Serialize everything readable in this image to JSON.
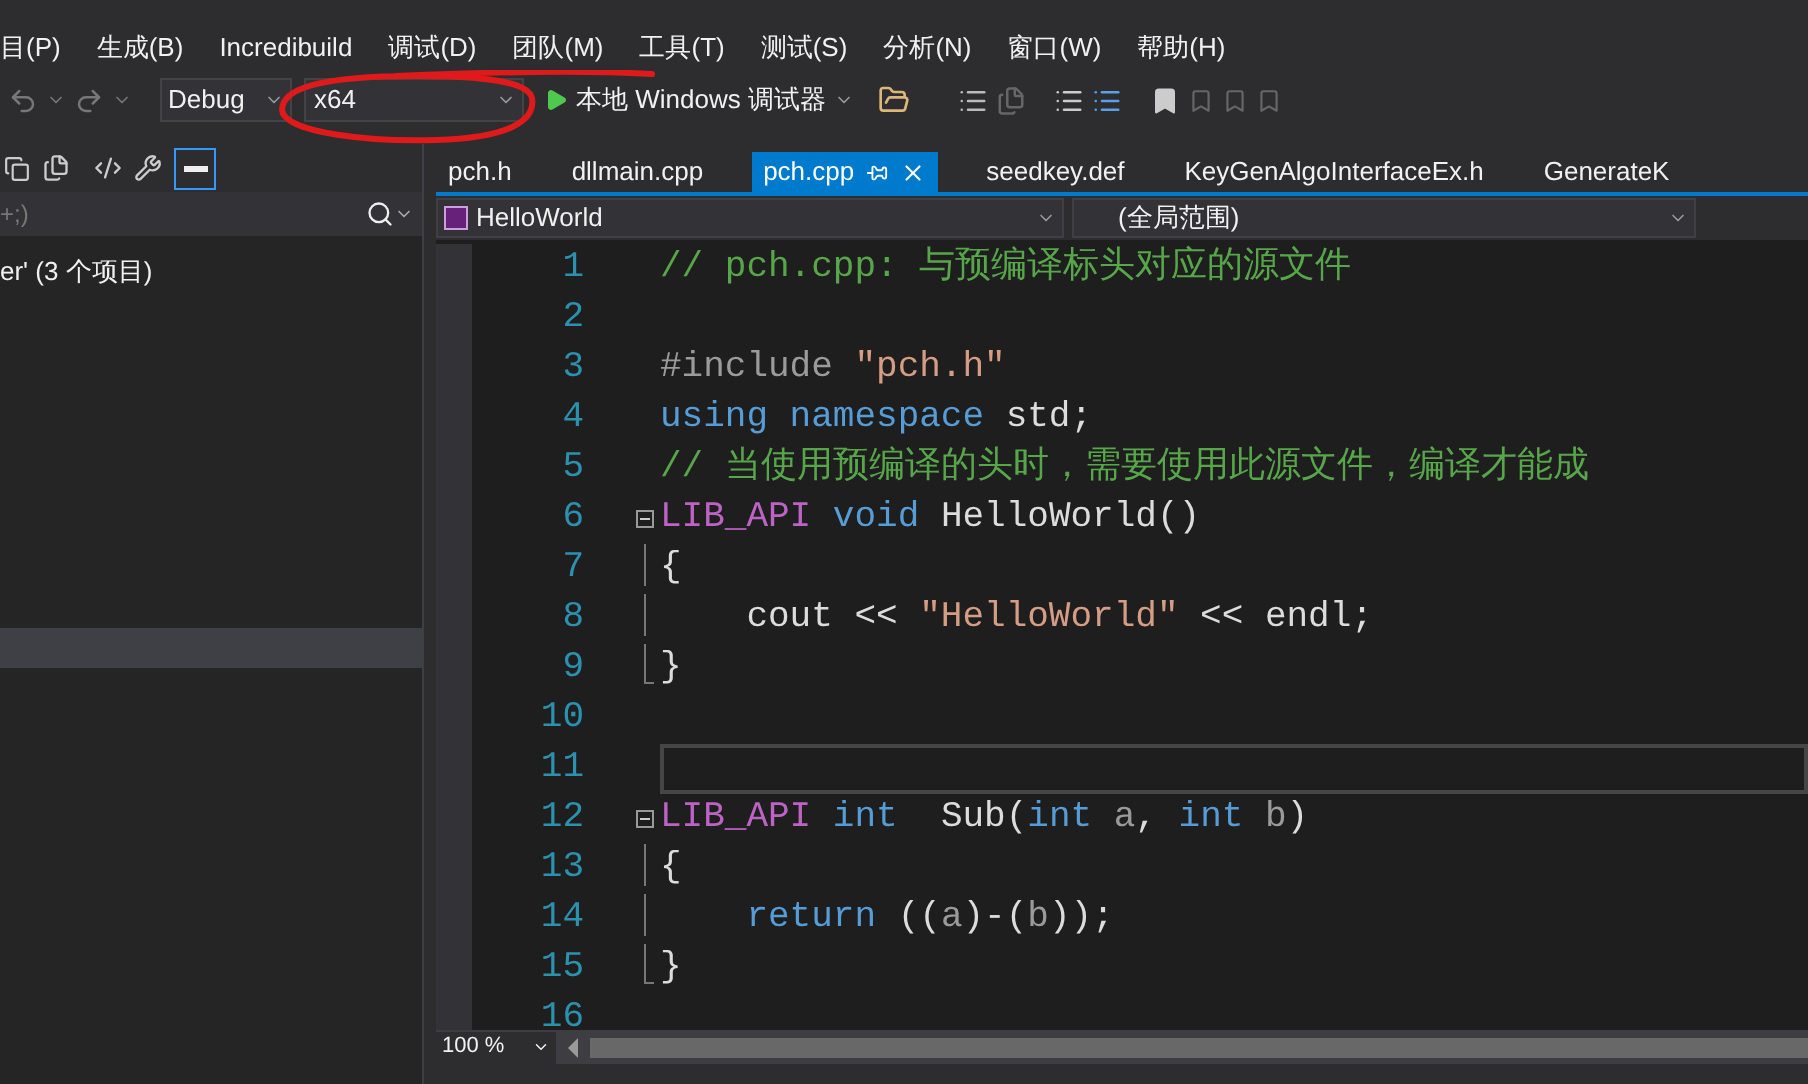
{
  "menu": [
    {
      "label": "目(P)"
    },
    {
      "label": "生成(B)"
    },
    {
      "label": "Incredibuild"
    },
    {
      "label": "调试(D)"
    },
    {
      "label": "团队(M)"
    },
    {
      "label": "工具(T)"
    },
    {
      "label": "测试(S)"
    },
    {
      "label": "分析(N)"
    },
    {
      "label": "窗口(W)"
    },
    {
      "label": "帮助(H)"
    }
  ],
  "toolbar": {
    "configuration": "Debug",
    "platform": "x64",
    "run_label": "本地 Windows 调试器"
  },
  "explorer": {
    "search_placeholder": "+;)",
    "items": [
      {
        "label": "er' (3 个项目)"
      }
    ]
  },
  "tabs": [
    {
      "label": "pch.h",
      "selected": false
    },
    {
      "label": "dllmain.cpp",
      "selected": false
    },
    {
      "label": "pch.cpp",
      "selected": true
    },
    {
      "label": "seedkey.def",
      "selected": false
    },
    {
      "label": "KeyGenAlgoInterfaceEx.h",
      "selected": false
    },
    {
      "label": "GenerateK",
      "selected": false
    }
  ],
  "navigation": {
    "member": "HelloWorld",
    "scope": "(全局范围)"
  },
  "code_lines": [
    {
      "number": "1",
      "current": false,
      "kind": "plain",
      "tokens": [
        {
          "kind": "comment",
          "text": "// pch.cpp: 与预编译标头对应的源文件"
        }
      ]
    },
    {
      "number": "2",
      "current": false,
      "kind": "plain"
    },
    {
      "number": "3",
      "current": false,
      "kind": "plain",
      "tokens": [
        {
          "kind": "preproc",
          "text": "#include "
        },
        {
          "kind": "string",
          "text": "\"pch.h\""
        }
      ]
    },
    {
      "number": "4",
      "current": false,
      "kind": "plain",
      "tokens": [
        {
          "kind": "keyword",
          "text": "using namespace"
        },
        {
          "kind": "plain",
          "text": " std;"
        }
      ]
    },
    {
      "number": "5",
      "current": false,
      "kind": "plain",
      "tokens": [
        {
          "kind": "comment",
          "text": "// 当使用预编译的头时，需要使用此源文件，编译才能成"
        }
      ]
    },
    {
      "number": "6",
      "current": false,
      "kind": "header",
      "tokens": [
        {
          "kind": "macro",
          "text": "LIB_API"
        },
        {
          "kind": "keyword",
          "text": " void"
        },
        {
          "kind": "plain",
          "text": " HelloWorld()"
        }
      ]
    },
    {
      "number": "7",
      "current": false,
      "kind": "body",
      "tokens": [
        {
          "kind": "plain",
          "text": "{"
        }
      ]
    },
    {
      "number": "8",
      "current": false,
      "kind": "body",
      "tokens": [
        {
          "kind": "plain",
          "text": "    cout << "
        },
        {
          "kind": "string",
          "text": "\"HelloWorld\""
        },
        {
          "kind": "plain",
          "text": " << endl;"
        }
      ]
    },
    {
      "number": "9",
      "current": false,
      "kind": "closing",
      "tokens": [
        {
          "kind": "plain",
          "text": "}"
        }
      ]
    },
    {
      "number": "10",
      "current": false,
      "kind": "plain"
    },
    {
      "number": "11",
      "current": true,
      "kind": "plain"
    },
    {
      "number": "12",
      "current": false,
      "kind": "header",
      "tokens": [
        {
          "kind": "macro",
          "text": "LIB_API"
        },
        {
          "kind": "keyword",
          "text": " int"
        },
        {
          "kind": "plain",
          "text": "  Sub("
        },
        {
          "kind": "keyword",
          "text": "int"
        },
        {
          "kind": "param",
          "text": " a"
        },
        {
          "kind": "plain",
          "text": ", "
        },
        {
          "kind": "keyword",
          "text": "int"
        },
        {
          "kind": "param",
          "text": " b"
        },
        {
          "kind": "plain",
          "text": ")"
        }
      ]
    },
    {
      "number": "13",
      "current": false,
      "kind": "body",
      "tokens": [
        {
          "kind": "plain",
          "text": "{"
        }
      ]
    },
    {
      "number": "14",
      "current": false,
      "kind": "body",
      "tokens": [
        {
          "kind": "keyword",
          "text": "    return"
        },
        {
          "kind": "plain",
          "text": " (("
        },
        {
          "kind": "param",
          "text": "a"
        },
        {
          "kind": "plain",
          "text": ")-("
        },
        {
          "kind": "param",
          "text": "b"
        },
        {
          "kind": "plain",
          "text": "));"
        }
      ]
    },
    {
      "number": "15",
      "current": false,
      "kind": "closing",
      "tokens": [
        {
          "kind": "plain",
          "text": "}"
        }
      ]
    },
    {
      "number": "16",
      "current": false,
      "kind": "plain"
    }
  ],
  "zoom": "100 %"
}
